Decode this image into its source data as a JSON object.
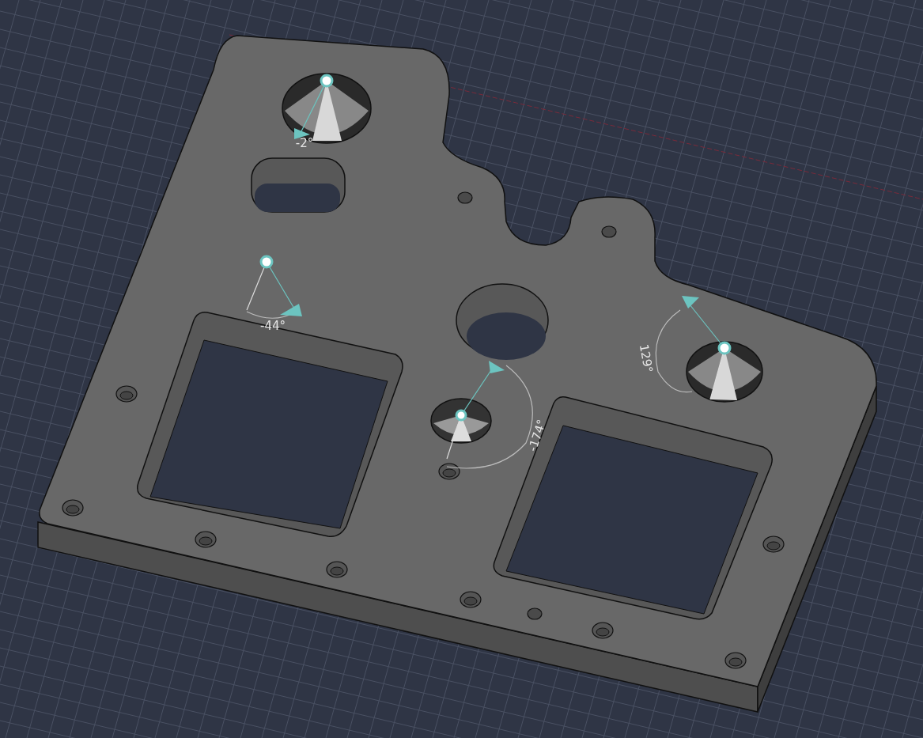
{
  "viewport": {
    "angle_labels": [
      {
        "text": "-2°"
      },
      {
        "text": "-44°"
      },
      {
        "text": "-174°"
      },
      {
        "text": "129°"
      }
    ]
  }
}
